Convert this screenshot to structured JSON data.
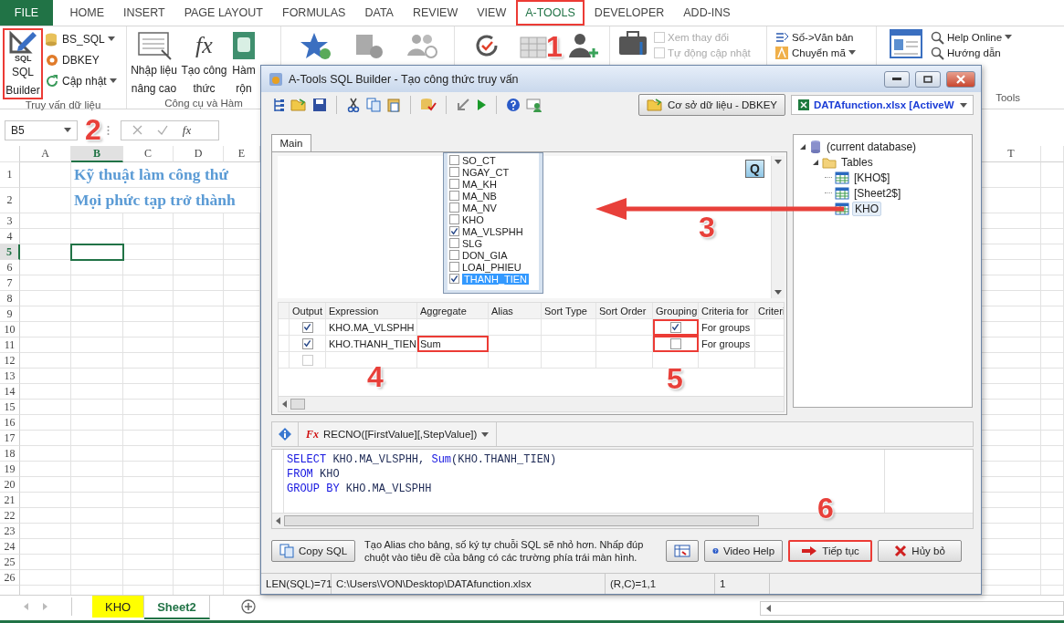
{
  "excel": {
    "ribbon_tabs": [
      {
        "label": "FILE",
        "kind": "file",
        "selected": false,
        "highlighted": false
      },
      {
        "label": "HOME",
        "kind": "tab",
        "selected": false,
        "highlighted": false
      },
      {
        "label": "INSERT",
        "kind": "tab",
        "selected": false,
        "highlighted": false
      },
      {
        "label": "PAGE LAYOUT",
        "kind": "tab",
        "selected": false,
        "highlighted": false
      },
      {
        "label": "FORMULAS",
        "kind": "tab",
        "selected": false,
        "highlighted": false
      },
      {
        "label": "DATA",
        "kind": "tab",
        "selected": false,
        "highlighted": false
      },
      {
        "label": "REVIEW",
        "kind": "tab",
        "selected": false,
        "highlighted": false
      },
      {
        "label": "VIEW",
        "kind": "tab",
        "selected": false,
        "highlighted": false
      },
      {
        "label": "A-TOOLS",
        "kind": "tab",
        "selected": true,
        "highlighted": true
      },
      {
        "label": "DEVELOPER",
        "kind": "tab",
        "selected": false,
        "highlighted": false
      },
      {
        "label": "ADD-INS",
        "kind": "tab",
        "selected": false,
        "highlighted": false
      }
    ],
    "ribbon": {
      "sql_builder": {
        "icon_text": "SQL",
        "lines": [
          "SQL",
          "Builder"
        ],
        "highlighted": true
      },
      "query_buttons": [
        {
          "label": "BS_SQL",
          "dropdown": true
        },
        {
          "label": "DBKEY",
          "dropdown": false
        },
        {
          "label": "Cập nhật",
          "dropdown": true
        }
      ],
      "query_group_label": "Truy vấn dữ liệu",
      "tool_buttons": [
        {
          "lines": [
            "Nhập liệu",
            "nâng cao"
          ]
        },
        {
          "lines": [
            "Tạo công",
            "thức"
          ],
          "icon_text": "fx"
        },
        {
          "lines": [
            "Hàm",
            "rộn"
          ]
        }
      ],
      "tool_group_label": "Công cụ và Hàm",
      "options": [
        {
          "label": "Xem thay đổi",
          "checked": false,
          "disabled": true
        },
        {
          "label": "Tự động cập nhật",
          "checked": false,
          "disabled": true
        }
      ],
      "convert_buttons": [
        {
          "label": "Số->Văn bản",
          "dropdown": false
        },
        {
          "label": "Chuyển mã",
          "dropdown": true
        }
      ],
      "help_buttons": [
        {
          "label": "Help Online",
          "dropdown": true
        },
        {
          "label": "Hướng dẫn",
          "dropdown": false
        }
      ],
      "tools_group_label": "Tools"
    },
    "formula_bar": {
      "name_box": "B5",
      "function_symbol": "fx"
    },
    "columns_left": [
      {
        "label": "A",
        "selected": false
      },
      {
        "label": "B",
        "selected": true
      },
      {
        "label": "C",
        "selected": false
      },
      {
        "label": "D",
        "selected": false
      },
      {
        "label": "E",
        "selected": false
      }
    ],
    "columns_right": [
      {
        "label": "T",
        "selected": false
      }
    ],
    "rows": [
      {
        "label": "1",
        "selected": false,
        "title_text": "Kỹ thuật làm công thứ"
      },
      {
        "label": "2",
        "selected": false,
        "title_text": "Mọi phức tạp trở thành"
      },
      {
        "label": "3",
        "selected": false
      },
      {
        "label": "4",
        "selected": false
      },
      {
        "label": "5",
        "selected": true
      },
      {
        "label": "6",
        "selected": false
      },
      {
        "label": "7",
        "selected": false
      },
      {
        "label": "8",
        "selected": false
      },
      {
        "label": "9",
        "selected": false
      },
      {
        "label": "10",
        "selected": false
      },
      {
        "label": "11",
        "selected": false
      },
      {
        "label": "12",
        "selected": false
      },
      {
        "label": "13",
        "selected": false
      },
      {
        "label": "14",
        "selected": false
      },
      {
        "label": "15",
        "selected": false
      },
      {
        "label": "16",
        "selected": false
      },
      {
        "label": "17",
        "selected": false
      },
      {
        "label": "18",
        "selected": false
      },
      {
        "label": "19",
        "selected": false
      },
      {
        "label": "20",
        "selected": false
      },
      {
        "label": "21",
        "selected": false
      },
      {
        "label": "22",
        "selected": false
      },
      {
        "label": "23",
        "selected": false
      },
      {
        "label": "24",
        "selected": false
      },
      {
        "label": "25",
        "selected": false
      },
      {
        "label": "26",
        "selected": false
      }
    ],
    "sheet_tabs": [
      {
        "label": "KHO",
        "selected": false,
        "color": "#ffff00"
      },
      {
        "label": "Sheet2",
        "selected": true
      }
    ]
  },
  "dialog": {
    "title": "A-Tools SQL Builder - Tạo công thức truy vấn",
    "db_button": "Cơ sở dữ liệu - DBKEY",
    "workbook_combo": "DATAfunction.xlsx [ActiveW",
    "tabs": [
      {
        "label": "Main",
        "selected": true
      }
    ],
    "q_button": "Q",
    "fields": [
      {
        "name": "SO_CT",
        "checked": false,
        "selected": false
      },
      {
        "name": "NGAY_CT",
        "checked": false,
        "selected": false
      },
      {
        "name": "MA_KH",
        "checked": false,
        "selected": false
      },
      {
        "name": "MA_NB",
        "checked": false,
        "selected": false
      },
      {
        "name": "MA_NV",
        "checked": false,
        "selected": false
      },
      {
        "name": "KHO",
        "checked": false,
        "selected": false
      },
      {
        "name": "MA_VLSPHH",
        "checked": true,
        "selected": false
      },
      {
        "name": "SLG",
        "checked": false,
        "selected": false
      },
      {
        "name": "DON_GIA",
        "checked": false,
        "selected": false
      },
      {
        "name": "LOAI_PHIEU",
        "checked": false,
        "selected": false
      },
      {
        "name": "THANH_TIEN",
        "checked": true,
        "selected": true
      }
    ],
    "grid_columns": [
      "Output",
      "Expression",
      "Aggregate",
      "Alias",
      "Sort Type",
      "Sort Order",
      "Grouping",
      "Criteria for",
      "Criteri"
    ],
    "grid_rows": [
      {
        "output": true,
        "expression": "KHO.MA_VLSPHH",
        "grouping": true,
        "grouping_highlighted": true,
        "criteria_for": "For groups"
      },
      {
        "output": true,
        "expression": "KHO.THANH_TIEN",
        "aggregate": "Sum",
        "aggregate_highlighted": true,
        "grouping": false,
        "grouping_highlighted": true,
        "criteria_for": "For groups"
      },
      {
        "output": false
      }
    ],
    "tree": [
      {
        "label": "(current database)",
        "kind": "database",
        "expanded": true,
        "selected": false,
        "children": [
          {
            "label": "Tables",
            "kind": "folder",
            "expanded": true,
            "selected": false,
            "children": [
              {
                "label": "[KHO$]",
                "kind": "table",
                "selected": false
              },
              {
                "label": "[Sheet2$]",
                "kind": "table",
                "selected": false
              },
              {
                "label": "KHO",
                "kind": "table",
                "selected": true
              }
            ]
          }
        ]
      }
    ],
    "function_icon_text": "Fx",
    "function_combo": "RECNO([FirstValue][,StepValue])",
    "sql_lines": [
      [
        {
          "text": "SELECT",
          "kind": "keyword"
        },
        {
          "text": " KHO.MA_VLSPHH, ",
          "kind": "plain"
        },
        {
          "text": "Sum",
          "kind": "keyword"
        },
        {
          "text": "(KHO.THANH_TIEN)",
          "kind": "plain"
        }
      ],
      [
        {
          "text": "FROM",
          "kind": "keyword"
        },
        {
          "text": " KHO",
          "kind": "plain"
        }
      ],
      [
        {
          "text": "GROUP BY",
          "kind": "keyword"
        },
        {
          "text": " KHO.MA_VLSPHH",
          "kind": "plain"
        }
      ]
    ],
    "copy_sql": "Copy SQL",
    "hint": "Tạo Alias cho bảng, số ký tự chuỗi SQL sẽ nhỏ hơn. Nhấp đúp chuột vào tiêu đề của bảng có các trường phía trái màn hình.",
    "buttons": [
      {
        "label": "Video Help",
        "kind": "help",
        "highlighted": false
      },
      {
        "label": "Tiếp tục",
        "kind": "next",
        "highlighted": true
      },
      {
        "label": "Hủy bỏ",
        "kind": "cancel",
        "highlighted": false
      }
    ],
    "status": [
      "LEN(SQL)=71",
      "C:\\Users\\VON\\Desktop\\DATAfunction.xlsx",
      "(R,C)=1,1",
      "1"
    ]
  },
  "annotations": [
    "1",
    "2",
    "3",
    "4",
    "5",
    "6"
  ]
}
